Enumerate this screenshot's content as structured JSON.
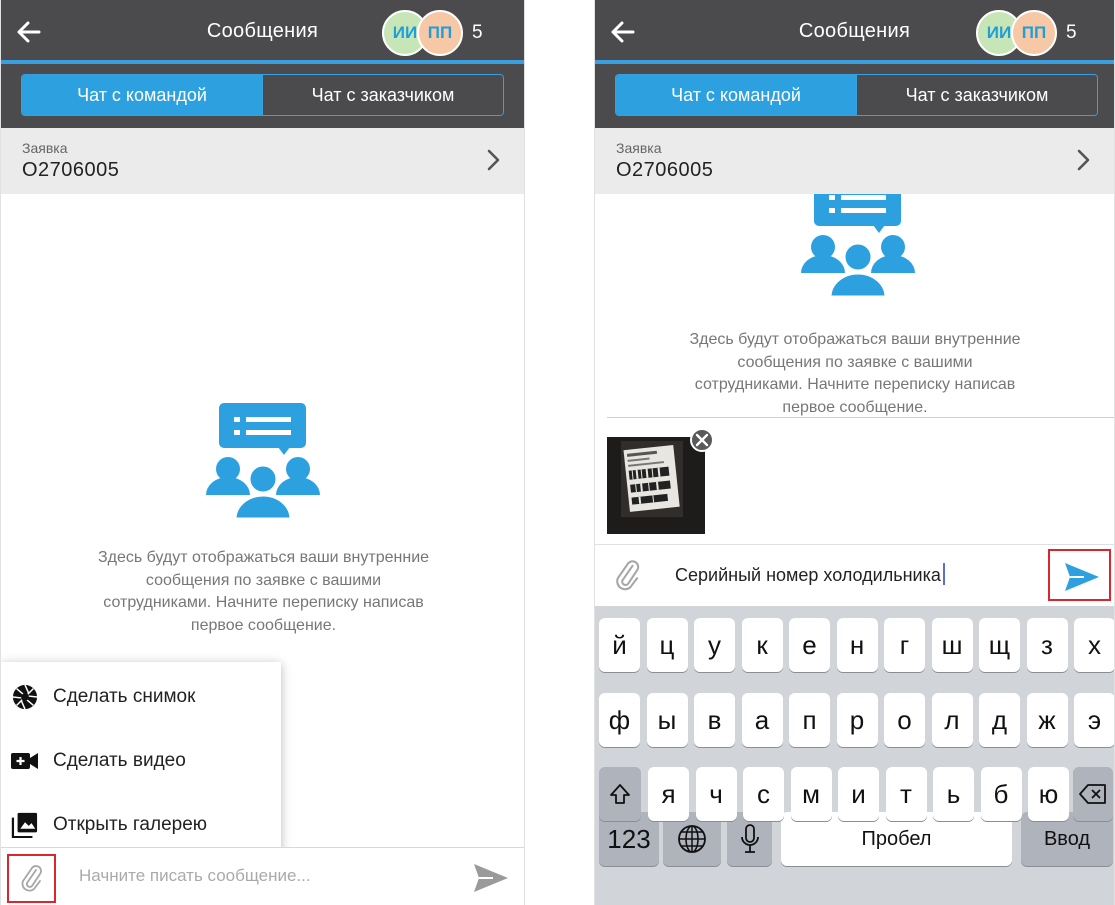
{
  "colors": {
    "accent": "#2da1e0",
    "header": "#4b4b4d",
    "highlight": "#d9272d"
  },
  "left": {
    "header": {
      "title": "Сообщения",
      "avatar1": "ИИ",
      "avatar2": "ПП",
      "count": "5"
    },
    "tabs": {
      "team": "Чат с командой",
      "customer": "Чат с заказчиком"
    },
    "order": {
      "label": "Заявка",
      "number": "O2706005"
    },
    "empty": {
      "line1": "Здесь будут отображаться ваши внутренние",
      "line2": "сообщения по заявке с вашими",
      "line3": "сотрудниками. Начните переписку написав",
      "line4": "первое сообщение."
    },
    "attach_menu": {
      "photo": "Сделать снимок",
      "video": "Сделать видео",
      "gallery": "Открыть галерею"
    },
    "composer": {
      "placeholder": "Начните писать сообщение..."
    }
  },
  "right": {
    "header": {
      "title": "Сообщения",
      "avatar1": "ИИ",
      "avatar2": "ПП",
      "count": "5"
    },
    "tabs": {
      "team": "Чат с командой",
      "customer": "Чат с заказчиком"
    },
    "order": {
      "label": "Заявка",
      "number": "O2706005"
    },
    "empty": {
      "line1": "Здесь будут отображаться ваши внутренние",
      "line2": "сообщения по заявке с вашими",
      "line3": "сотрудниками. Начните переписку написав",
      "line4": "первое сообщение."
    },
    "composer": {
      "value": "Серийный номер холодильника"
    },
    "keyboard": {
      "row1": [
        "й",
        "ц",
        "у",
        "к",
        "е",
        "н",
        "г",
        "ш",
        "щ",
        "з",
        "х"
      ],
      "row2": [
        "ф",
        "ы",
        "в",
        "а",
        "п",
        "р",
        "о",
        "л",
        "д",
        "ж",
        "э"
      ],
      "row3": [
        "я",
        "ч",
        "с",
        "м",
        "и",
        "т",
        "ь",
        "б",
        "ю"
      ],
      "numbers": "123",
      "space": "Пробел",
      "enter": "Ввод"
    }
  }
}
